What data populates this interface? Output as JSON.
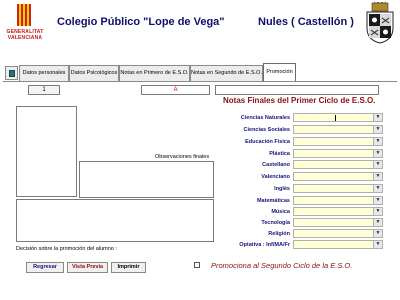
{
  "header": {
    "logo_left_text": [
      "GENERALITAT",
      "VALENCIANA"
    ],
    "school_name": "Colegio Público \"Lope de Vega\"",
    "town": "Nules ( Castellón )"
  },
  "tabs": [
    {
      "label": "Datos personales",
      "active": false
    },
    {
      "label": "Datos Psicológicos",
      "active": false
    },
    {
      "label": "Notas en Primero de E.S.O.",
      "active": false
    },
    {
      "label": "Notas en Segundo de E.S.O.",
      "active": false
    },
    {
      "label": "Promoción",
      "active": true
    }
  ],
  "form": {
    "record_number": "1",
    "group_value": "A",
    "section_title": "Notas Finales del Primer Ciclo de E.S.O.",
    "observations_label": "Observaciones finales",
    "decision_label": "Decisión sobre la promoción del alumno :",
    "promote_label": "Promociona al Segundo Ciclo de la E.S.O."
  },
  "subjects": [
    {
      "label": "Ciencias Naturales",
      "value": ""
    },
    {
      "label": "Ciencias Sociales",
      "value": ""
    },
    {
      "label": "Educación Física",
      "value": ""
    },
    {
      "label": "Plástica",
      "value": ""
    },
    {
      "label": "Castellano",
      "value": ""
    },
    {
      "label": "Valenciano",
      "value": ""
    },
    {
      "label": "Inglés",
      "value": ""
    },
    {
      "label": "Matemáticas",
      "value": ""
    },
    {
      "label": "Música",
      "value": ""
    },
    {
      "label": "Tecnología",
      "value": ""
    },
    {
      "label": "Religión",
      "value": ""
    },
    {
      "label": "Optativa : Inf/MA/Fr",
      "value": ""
    }
  ],
  "buttons": {
    "back": "Regresar",
    "preview": "Vista Previa",
    "print": "Imprimir"
  },
  "colors": {
    "header_text": "#10106a",
    "section_title": "#8a1010",
    "subject_label": "#13137a",
    "combo_bg": "#ffffd8",
    "group_value": "#cc0000"
  }
}
